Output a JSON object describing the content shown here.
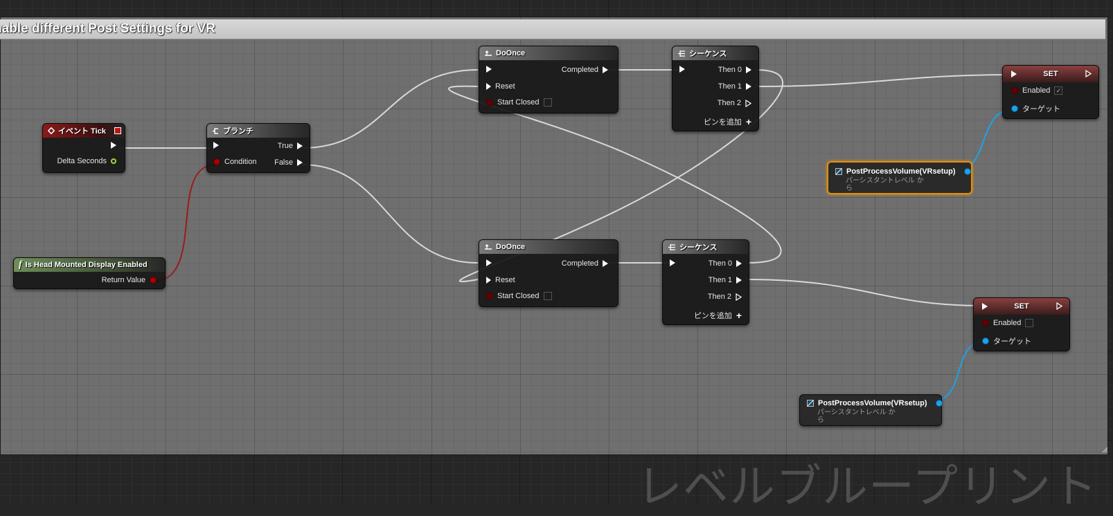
{
  "comment": {
    "title": "nable different Post Settings for VR"
  },
  "watermark": "レベルブループリント",
  "nodes": {
    "event_tick": {
      "title": "イベント Tick",
      "delta": "Delta Seconds"
    },
    "branch": {
      "title": "ブランチ",
      "condition": "Condition",
      "true_label": "True",
      "false_label": "False"
    },
    "hmd": {
      "title": "Is Head Mounted Display Enabled",
      "return_value": "Return Value"
    },
    "doonce_top": {
      "title": "DoOnce",
      "completed": "Completed",
      "reset": "Reset",
      "start_closed": "Start Closed"
    },
    "doonce_bottom": {
      "title": "DoOnce",
      "completed": "Completed",
      "reset": "Reset",
      "start_closed": "Start Closed"
    },
    "sequence_top": {
      "title": "シーケンス",
      "then0": "Then 0",
      "then1": "Then 1",
      "then2": "Then 2",
      "add_pin": "ピンを追加"
    },
    "sequence_bottom": {
      "title": "シーケンス",
      "then0": "Then 0",
      "then1": "Then 1",
      "then2": "Then 2",
      "add_pin": "ピンを追加"
    },
    "set_top": {
      "title": "SET",
      "enabled": "Enabled",
      "target": "ターゲット",
      "enabled_checked": true,
      "enabled_mark": "✓"
    },
    "set_bottom": {
      "title": "SET",
      "enabled": "Enabled",
      "target": "ターゲット",
      "enabled_checked": false
    },
    "ppv_top": {
      "title": "PostProcessVolume(VRsetup)",
      "subtitle_line1": "パーシスタントレベル か",
      "subtitle_line2": "ら"
    },
    "ppv_bottom": {
      "title": "PostProcessVolume(VRsetup)",
      "subtitle_line1": "パーシスタントレベル か",
      "subtitle_line2": "ら"
    }
  },
  "colors": {
    "exec_wire": "#d9d9d9",
    "bool_wire": "#9b1c1c",
    "object_wire": "#1da2e8",
    "selection": "#e2900f",
    "event_header": "#8a1a1a",
    "function_header": "#6f8e5a"
  },
  "icons": {
    "event": "diamond-event-icon",
    "branch": "branch-icon",
    "function": "function-f-icon",
    "doonce": "doonce-icon",
    "sequence": "sequence-icon",
    "variable": "variable-reference-icon"
  }
}
